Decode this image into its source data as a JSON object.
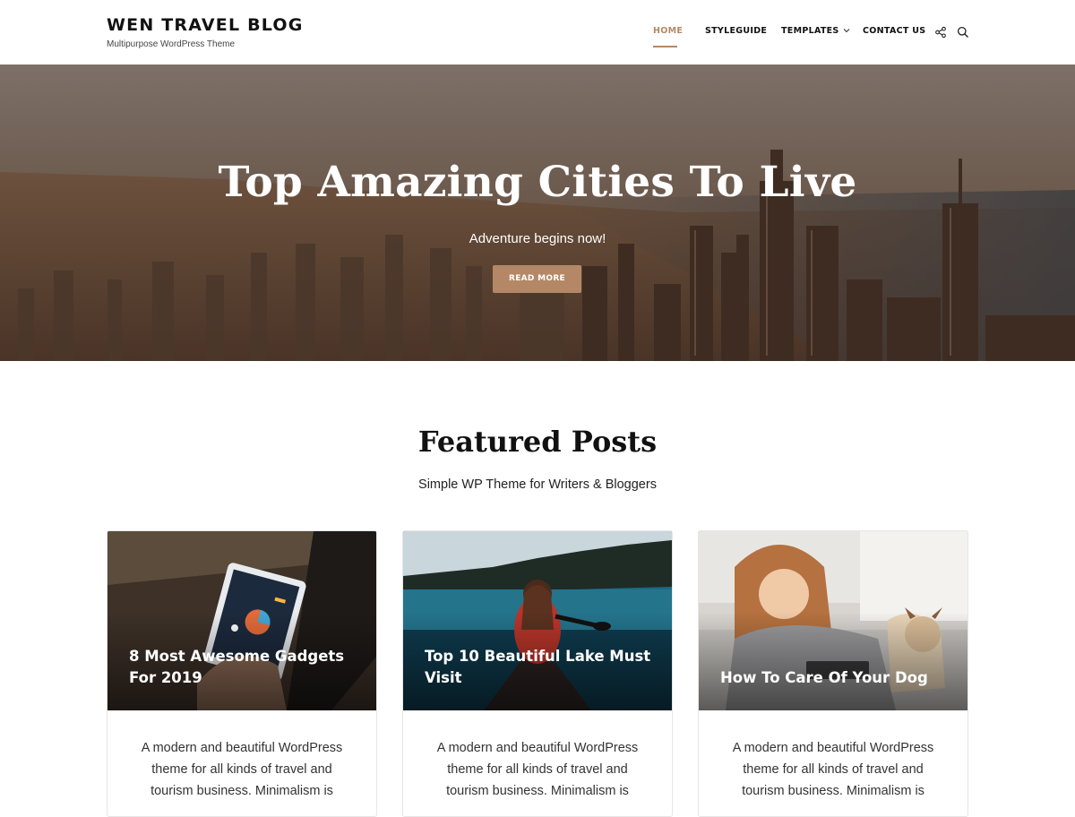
{
  "header": {
    "site_title": "WEN TRAVEL BLOG",
    "tagline": "Multipurpose WordPress Theme",
    "nav": {
      "home": "HOME",
      "styleguide": "STYLEGUIDE",
      "templates": "TEMPLATES",
      "contact": "CONTACT US"
    },
    "icons": {
      "share": "share-icon",
      "search": "search-icon",
      "dropdown": "chevron-down-icon"
    }
  },
  "hero": {
    "title": "Top Amazing Cities To Live",
    "subtitle": "Adventure begins now!",
    "button": "READ MORE"
  },
  "featured": {
    "title": "Featured Posts",
    "subtitle": "Simple WP Theme for Writers & Bloggers",
    "cards": [
      {
        "title": "8 Most Awesome Gadgets For 2019",
        "excerpt": "A modern and beautiful WordPress theme for all kinds of travel and tourism business. Minimalism is"
      },
      {
        "title": "Top 10 Beautiful Lake Must Visit",
        "excerpt": "A modern and beautiful WordPress theme for all kinds of travel and tourism business. Minimalism is"
      },
      {
        "title": "How To Care Of Your Dog",
        "excerpt": "A modern and beautiful WordPress theme for all kinds of travel and tourism business. Minimalism is"
      }
    ]
  },
  "colors": {
    "accent": "#b48866",
    "text": "#111111",
    "white": "#ffffff"
  }
}
